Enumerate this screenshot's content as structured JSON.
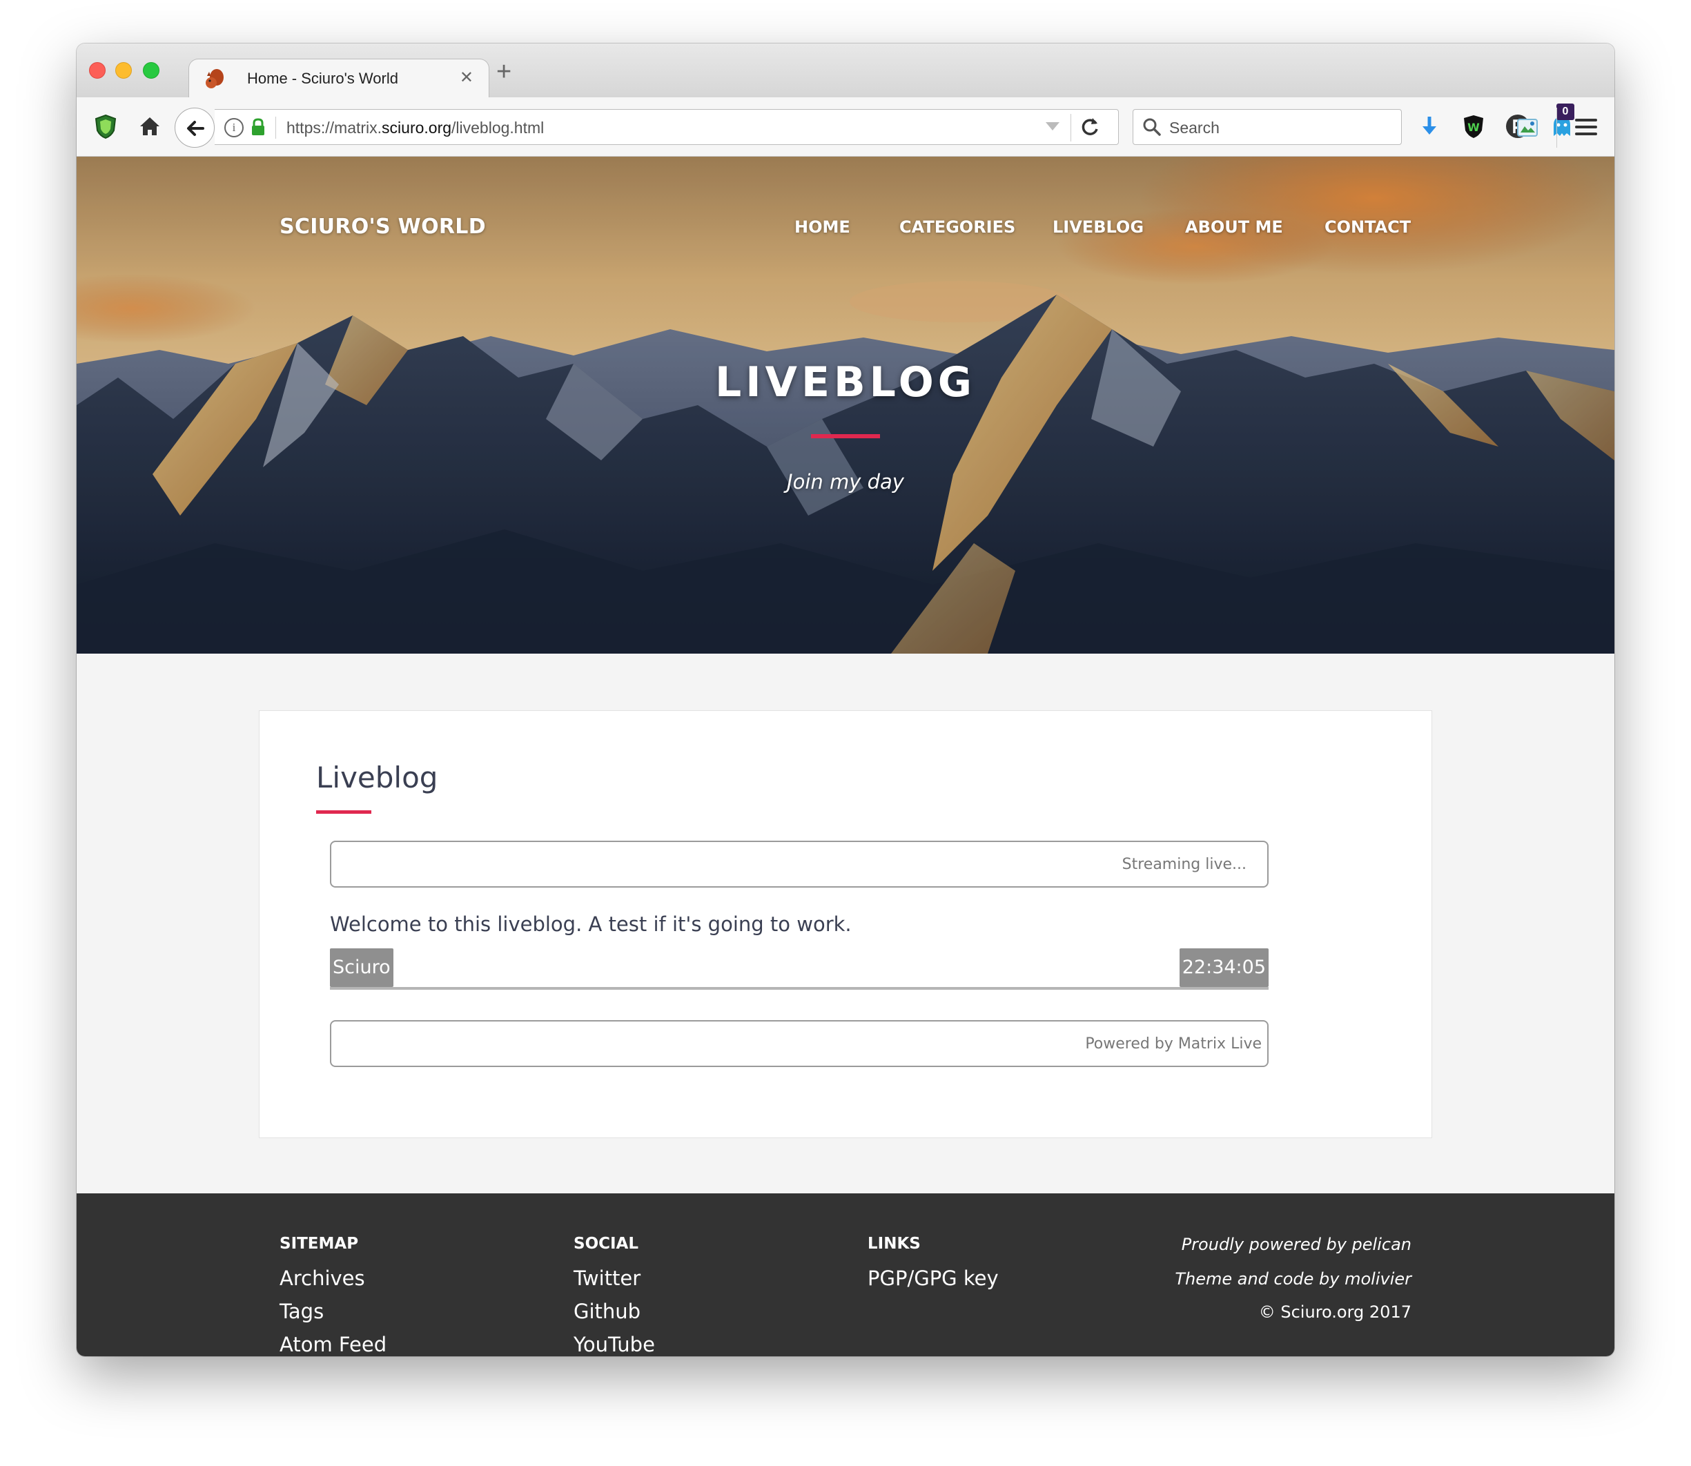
{
  "browser": {
    "tab_title": "Home - Sciuro's World",
    "tab_close": "✕",
    "new_tab": "+",
    "url_prefix": "https://matrix.",
    "url_host": "sciuro.org",
    "url_path": "/liveblog.html",
    "search_placeholder": "Search",
    "notification_badge": "0"
  },
  "site": {
    "title": "SCIURO'S WORLD",
    "nav": [
      "HOME",
      "CATEGORIES",
      "LIVEBLOG",
      "ABOUT ME",
      "CONTACT"
    ]
  },
  "hero": {
    "title": "LIVEBLOG",
    "subtitle": "Join my day",
    "accent_color": "#e0284f"
  },
  "liveblog": {
    "heading": "Liveblog",
    "status": "Streaming live...",
    "message": "Welcome to this liveblog. A test if it's going to work.",
    "author": "Sciuro",
    "time": "22:34:05",
    "powered_by": "Powered by Matrix Live"
  },
  "footer": {
    "sitemap": {
      "heading": "SITEMAP",
      "links": [
        "Archives",
        "Tags",
        "Atom Feed"
      ]
    },
    "social": {
      "heading": "SOCIAL",
      "links": [
        "Twitter",
        "Github",
        "YouTube"
      ]
    },
    "links": {
      "heading": "LINKS",
      "links": [
        "PGP/GPG key"
      ]
    },
    "credits": [
      "Proudly powered by pelican",
      "Theme and code by molivier"
    ],
    "copyright": "© Sciuro.org 2017"
  },
  "icons": [
    "ublock-shield-icon",
    "home-icon",
    "back-arrow-icon",
    "info-icon",
    "lock-icon",
    "dropdown-icon",
    "reload-icon",
    "search-icon",
    "download-icon",
    "wot-shield-icon",
    "pocket-icon",
    "ghostery-icon",
    "extension-icon",
    "hamburger-menu-icon"
  ]
}
